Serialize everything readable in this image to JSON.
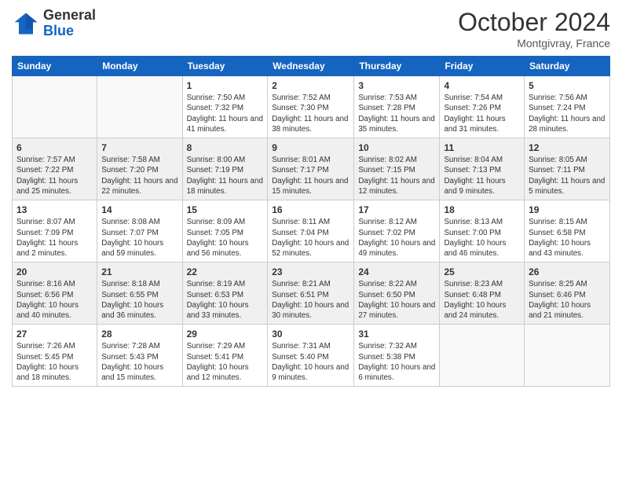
{
  "header": {
    "logo_general": "General",
    "logo_blue": "Blue",
    "month_title": "October 2024",
    "location": "Montgivray, France"
  },
  "days_of_week": [
    "Sunday",
    "Monday",
    "Tuesday",
    "Wednesday",
    "Thursday",
    "Friday",
    "Saturday"
  ],
  "weeks": [
    [
      {
        "day": "",
        "info": ""
      },
      {
        "day": "",
        "info": ""
      },
      {
        "day": "1",
        "info": "Sunrise: 7:50 AM\nSunset: 7:32 PM\nDaylight: 11 hours and 41 minutes."
      },
      {
        "day": "2",
        "info": "Sunrise: 7:52 AM\nSunset: 7:30 PM\nDaylight: 11 hours and 38 minutes."
      },
      {
        "day": "3",
        "info": "Sunrise: 7:53 AM\nSunset: 7:28 PM\nDaylight: 11 hours and 35 minutes."
      },
      {
        "day": "4",
        "info": "Sunrise: 7:54 AM\nSunset: 7:26 PM\nDaylight: 11 hours and 31 minutes."
      },
      {
        "day": "5",
        "info": "Sunrise: 7:56 AM\nSunset: 7:24 PM\nDaylight: 11 hours and 28 minutes."
      }
    ],
    [
      {
        "day": "6",
        "info": "Sunrise: 7:57 AM\nSunset: 7:22 PM\nDaylight: 11 hours and 25 minutes."
      },
      {
        "day": "7",
        "info": "Sunrise: 7:58 AM\nSunset: 7:20 PM\nDaylight: 11 hours and 22 minutes."
      },
      {
        "day": "8",
        "info": "Sunrise: 8:00 AM\nSunset: 7:19 PM\nDaylight: 11 hours and 18 minutes."
      },
      {
        "day": "9",
        "info": "Sunrise: 8:01 AM\nSunset: 7:17 PM\nDaylight: 11 hours and 15 minutes."
      },
      {
        "day": "10",
        "info": "Sunrise: 8:02 AM\nSunset: 7:15 PM\nDaylight: 11 hours and 12 minutes."
      },
      {
        "day": "11",
        "info": "Sunrise: 8:04 AM\nSunset: 7:13 PM\nDaylight: 11 hours and 9 minutes."
      },
      {
        "day": "12",
        "info": "Sunrise: 8:05 AM\nSunset: 7:11 PM\nDaylight: 11 hours and 5 minutes."
      }
    ],
    [
      {
        "day": "13",
        "info": "Sunrise: 8:07 AM\nSunset: 7:09 PM\nDaylight: 11 hours and 2 minutes."
      },
      {
        "day": "14",
        "info": "Sunrise: 8:08 AM\nSunset: 7:07 PM\nDaylight: 10 hours and 59 minutes."
      },
      {
        "day": "15",
        "info": "Sunrise: 8:09 AM\nSunset: 7:05 PM\nDaylight: 10 hours and 56 minutes."
      },
      {
        "day": "16",
        "info": "Sunrise: 8:11 AM\nSunset: 7:04 PM\nDaylight: 10 hours and 52 minutes."
      },
      {
        "day": "17",
        "info": "Sunrise: 8:12 AM\nSunset: 7:02 PM\nDaylight: 10 hours and 49 minutes."
      },
      {
        "day": "18",
        "info": "Sunrise: 8:13 AM\nSunset: 7:00 PM\nDaylight: 10 hours and 46 minutes."
      },
      {
        "day": "19",
        "info": "Sunrise: 8:15 AM\nSunset: 6:58 PM\nDaylight: 10 hours and 43 minutes."
      }
    ],
    [
      {
        "day": "20",
        "info": "Sunrise: 8:16 AM\nSunset: 6:56 PM\nDaylight: 10 hours and 40 minutes."
      },
      {
        "day": "21",
        "info": "Sunrise: 8:18 AM\nSunset: 6:55 PM\nDaylight: 10 hours and 36 minutes."
      },
      {
        "day": "22",
        "info": "Sunrise: 8:19 AM\nSunset: 6:53 PM\nDaylight: 10 hours and 33 minutes."
      },
      {
        "day": "23",
        "info": "Sunrise: 8:21 AM\nSunset: 6:51 PM\nDaylight: 10 hours and 30 minutes."
      },
      {
        "day": "24",
        "info": "Sunrise: 8:22 AM\nSunset: 6:50 PM\nDaylight: 10 hours and 27 minutes."
      },
      {
        "day": "25",
        "info": "Sunrise: 8:23 AM\nSunset: 6:48 PM\nDaylight: 10 hours and 24 minutes."
      },
      {
        "day": "26",
        "info": "Sunrise: 8:25 AM\nSunset: 6:46 PM\nDaylight: 10 hours and 21 minutes."
      }
    ],
    [
      {
        "day": "27",
        "info": "Sunrise: 7:26 AM\nSunset: 5:45 PM\nDaylight: 10 hours and 18 minutes."
      },
      {
        "day": "28",
        "info": "Sunrise: 7:28 AM\nSunset: 5:43 PM\nDaylight: 10 hours and 15 minutes."
      },
      {
        "day": "29",
        "info": "Sunrise: 7:29 AM\nSunset: 5:41 PM\nDaylight: 10 hours and 12 minutes."
      },
      {
        "day": "30",
        "info": "Sunrise: 7:31 AM\nSunset: 5:40 PM\nDaylight: 10 hours and 9 minutes."
      },
      {
        "day": "31",
        "info": "Sunrise: 7:32 AM\nSunset: 5:38 PM\nDaylight: 10 hours and 6 minutes."
      },
      {
        "day": "",
        "info": ""
      },
      {
        "day": "",
        "info": ""
      }
    ]
  ]
}
